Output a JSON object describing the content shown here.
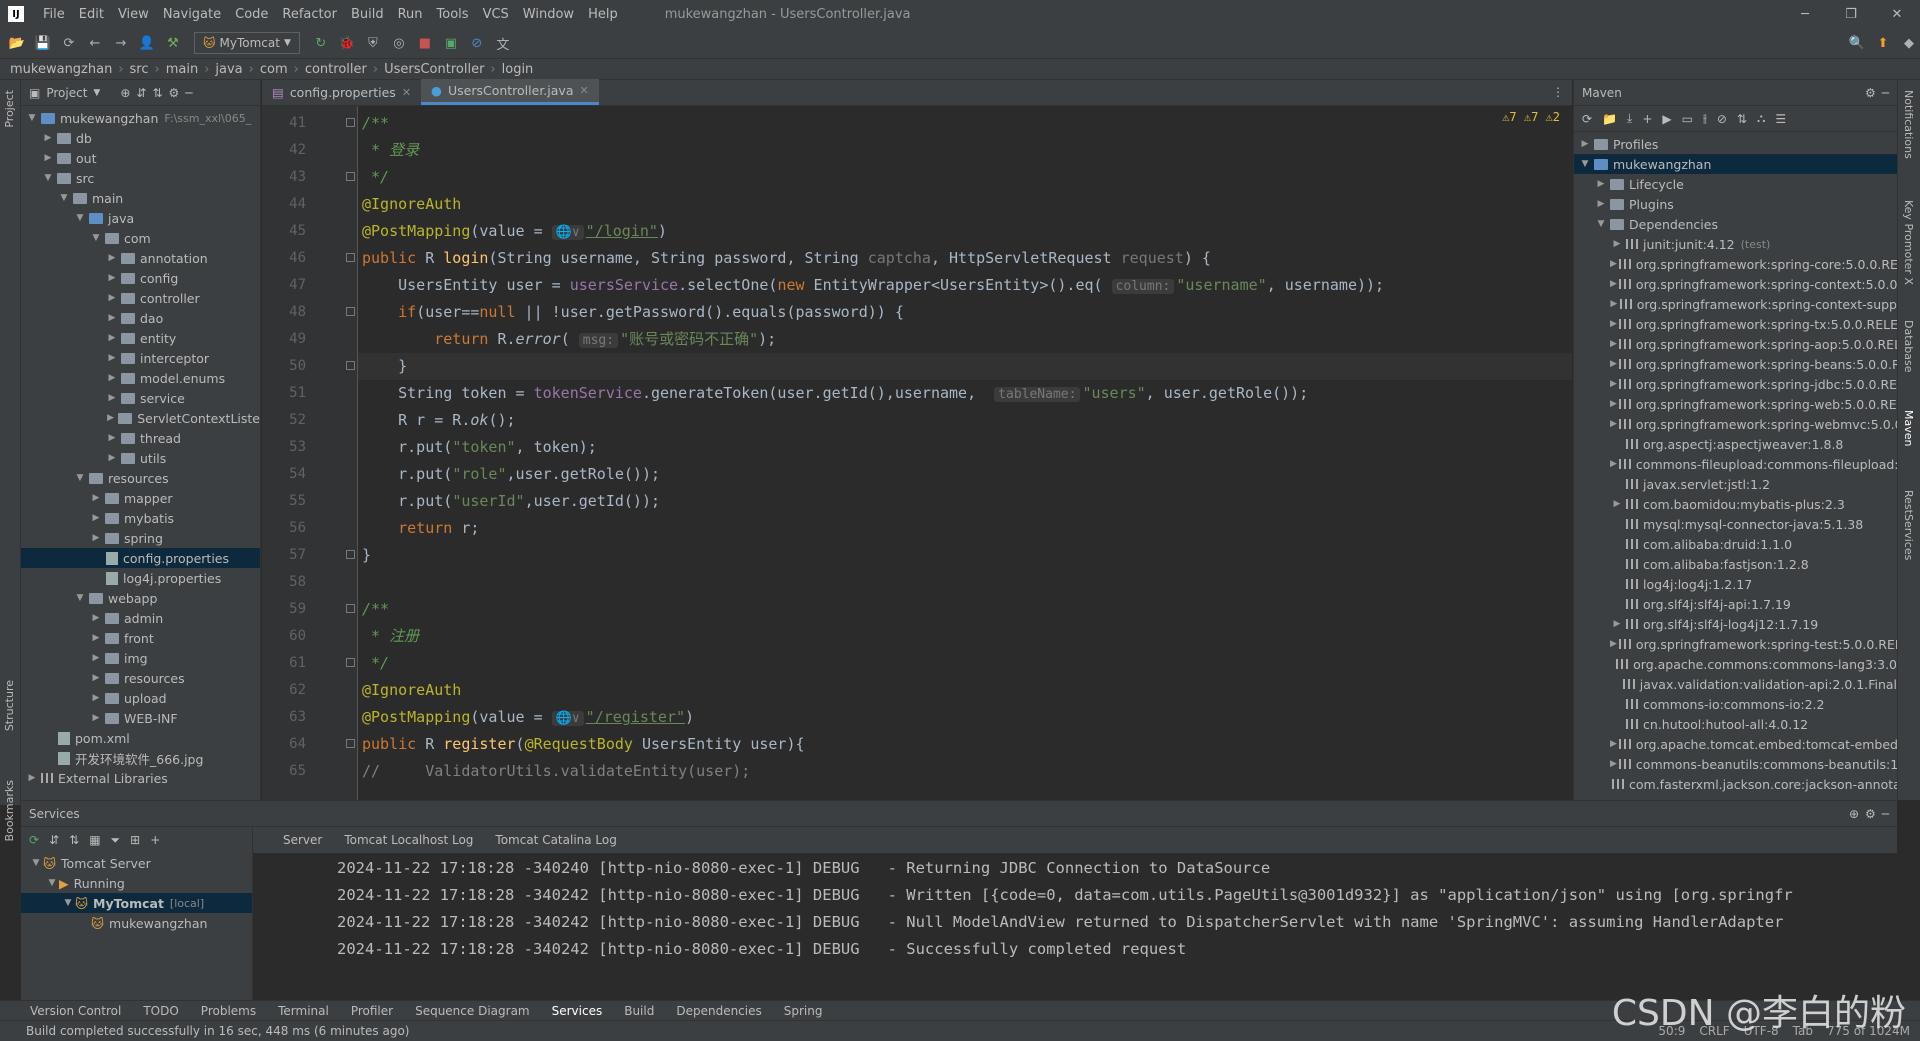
{
  "menubar": {
    "logo": "IJ",
    "items": [
      "File",
      "Edit",
      "View",
      "Navigate",
      "Code",
      "Refactor",
      "Build",
      "Run",
      "Tools",
      "VCS",
      "Window",
      "Help"
    ],
    "title": "mukewangzhan - UsersController.java"
  },
  "toolbar": {
    "run_config": "MyTomcat"
  },
  "breadcrumbs": [
    "mukewangzhan",
    "src",
    "main",
    "java",
    "com",
    "controller",
    "UsersController",
    "login"
  ],
  "project": {
    "header": "Project",
    "tree": [
      {
        "d": 0,
        "label": "mukewangzhan",
        "extra": "F:\\ssm_xxl\\065_",
        "o": true,
        "t": "mod"
      },
      {
        "d": 1,
        "label": "db",
        "o": false,
        "t": "f"
      },
      {
        "d": 1,
        "label": "out",
        "o": false,
        "t": "f"
      },
      {
        "d": 1,
        "label": "src",
        "o": true,
        "t": "f"
      },
      {
        "d": 2,
        "label": "main",
        "o": true,
        "t": "f"
      },
      {
        "d": 3,
        "label": "java",
        "o": true,
        "t": "b"
      },
      {
        "d": 4,
        "label": "com",
        "o": true,
        "t": "f"
      },
      {
        "d": 5,
        "label": "annotation",
        "o": false,
        "t": "f"
      },
      {
        "d": 5,
        "label": "config",
        "o": false,
        "t": "f"
      },
      {
        "d": 5,
        "label": "controller",
        "o": false,
        "t": "f"
      },
      {
        "d": 5,
        "label": "dao",
        "o": false,
        "t": "f"
      },
      {
        "d": 5,
        "label": "entity",
        "o": false,
        "t": "f"
      },
      {
        "d": 5,
        "label": "interceptor",
        "o": false,
        "t": "f"
      },
      {
        "d": 5,
        "label": "model.enums",
        "o": false,
        "t": "f"
      },
      {
        "d": 5,
        "label": "service",
        "o": false,
        "t": "f"
      },
      {
        "d": 5,
        "label": "ServletContextListe",
        "o": false,
        "t": "f"
      },
      {
        "d": 5,
        "label": "thread",
        "o": false,
        "t": "f"
      },
      {
        "d": 5,
        "label": "utils",
        "o": false,
        "t": "f"
      },
      {
        "d": 3,
        "label": "resources",
        "o": true,
        "t": "f"
      },
      {
        "d": 4,
        "label": "mapper",
        "o": false,
        "t": "f"
      },
      {
        "d": 4,
        "label": "mybatis",
        "o": false,
        "t": "f"
      },
      {
        "d": 4,
        "label": "spring",
        "o": false,
        "t": "f"
      },
      {
        "d": 4,
        "label": "config.properties",
        "o": null,
        "t": "file",
        "sel": true
      },
      {
        "d": 4,
        "label": "log4j.properties",
        "o": null,
        "t": "file"
      },
      {
        "d": 3,
        "label": "webapp",
        "o": true,
        "t": "f"
      },
      {
        "d": 4,
        "label": "admin",
        "o": false,
        "t": "f"
      },
      {
        "d": 4,
        "label": "front",
        "o": false,
        "t": "f"
      },
      {
        "d": 4,
        "label": "img",
        "o": false,
        "t": "f"
      },
      {
        "d": 4,
        "label": "resources",
        "o": false,
        "t": "f"
      },
      {
        "d": 4,
        "label": "upload",
        "o": false,
        "t": "f"
      },
      {
        "d": 4,
        "label": "WEB-INF",
        "o": false,
        "t": "f"
      },
      {
        "d": 1,
        "label": "pom.xml",
        "o": null,
        "t": "file"
      },
      {
        "d": 1,
        "label": "开发环境软件_666.jpg",
        "o": null,
        "t": "file"
      },
      {
        "d": 0,
        "label": "External Libraries",
        "o": false,
        "t": "lib"
      }
    ]
  },
  "editor": {
    "tabs": [
      "config.properties",
      "UsersController.java"
    ],
    "warnings": "⚠7  ⚠7  ⚠2",
    "lines": [
      {
        "n": "41",
        "h": "<span class='cm'>/**</span>"
      },
      {
        "n": "42",
        "h": "<span class='cm'> * 登录</span>"
      },
      {
        "n": "43",
        "h": "<span class='cm'> */</span>"
      },
      {
        "n": "44",
        "h": "<span class='an'>@IgnoreAuth</span>"
      },
      {
        "n": "45",
        "h": "<span class='an'>@PostMapping</span>(value = <span class='hint'>🌐∨</span><span class='link'>\"/login\"</span>)"
      },
      {
        "n": "46",
        "h": "<span class='kw'>public</span> R <span class='mth'>login</span>(String username, String password, String <span style='color:#777'>captcha</span>, HttpServletRequest <span style='color:#777'>request</span>) {"
      },
      {
        "n": "47",
        "h": "    UsersEntity user = <span class='fld'>usersService</span>.selectOne(<span class='kw'>new</span> EntityWrapper&lt;UsersEntity&gt;().eq( <span class='hint'>column:</span><span class='str'>\"username\"</span>, username));"
      },
      {
        "n": "48",
        "h": "    <span class='kw'>if</span>(user==<span class='kw'>null</span> || !user.getPassword().equals(password)) {"
      },
      {
        "n": "49",
        "h": "        <span class='kw'>return</span> R.<span class='it'>error</span>( <span class='hint'>msg:</span><span class='str'>\"账号或密码不正确\"</span>);"
      },
      {
        "n": "50",
        "h": "    }"
      },
      {
        "n": "51",
        "h": "    String token = <span class='fld'>tokenService</span>.generateToken(user.getId(),username,  <span class='hint'>tableName:</span><span class='str'>\"users\"</span>, user.getRole());"
      },
      {
        "n": "52",
        "h": "    R r = R.<span class='it'>ok</span>();"
      },
      {
        "n": "53",
        "h": "    r.put(<span class='str'>\"token\"</span>, token);"
      },
      {
        "n": "54",
        "h": "    r.put(<span class='str'>\"role\"</span>,user.getRole());"
      },
      {
        "n": "55",
        "h": "    r.put(<span class='str'>\"userId\"</span>,user.getId());"
      },
      {
        "n": "56",
        "h": "    <span class='kw'>return</span> r;"
      },
      {
        "n": "57",
        "h": "}"
      },
      {
        "n": "58",
        "h": ""
      },
      {
        "n": "59",
        "h": "<span class='cm'>/**</span>"
      },
      {
        "n": "60",
        "h": "<span class='cm'> * 注册</span>"
      },
      {
        "n": "61",
        "h": "<span class='cm'> */</span>"
      },
      {
        "n": "62",
        "h": "<span class='an'>@IgnoreAuth</span>"
      },
      {
        "n": "63",
        "h": "<span class='an'>@PostMapping</span>(value = <span class='hint'>🌐∨</span><span class='link'>\"/register\"</span>)"
      },
      {
        "n": "64",
        "h": "<span class='kw'>public</span> R <span class='mth'>register</span>(<span class='an'>@RequestBody</span> UsersEntity user){"
      },
      {
        "n": "65",
        "h": "<span style='color:#808080'>//     ValidatorUtils.validateEntity(user);</span>"
      }
    ]
  },
  "maven": {
    "header": "Maven",
    "tree": [
      {
        "d": 0,
        "label": "Profiles",
        "o": false,
        "t": "f"
      },
      {
        "d": 0,
        "label": "mukewangzhan",
        "o": true,
        "t": "mod",
        "sel": true
      },
      {
        "d": 1,
        "label": "Lifecycle",
        "o": false,
        "t": "f"
      },
      {
        "d": 1,
        "label": "Plugins",
        "o": false,
        "t": "f"
      },
      {
        "d": 1,
        "label": "Dependencies",
        "o": true,
        "t": "f"
      },
      {
        "d": 2,
        "label": "junit:junit:4.12",
        "extra": "(test)",
        "o": false,
        "t": "dep"
      },
      {
        "d": 2,
        "label": "org.springframework:spring-core:5.0.0.RELE",
        "o": false,
        "t": "dep"
      },
      {
        "d": 2,
        "label": "org.springframework:spring-context:5.0.0.RE",
        "o": false,
        "t": "dep"
      },
      {
        "d": 2,
        "label": "org.springframework:spring-context-supp",
        "o": false,
        "t": "dep"
      },
      {
        "d": 2,
        "label": "org.springframework:spring-tx:5.0.0.RELEA",
        "o": false,
        "t": "dep"
      },
      {
        "d": 2,
        "label": "org.springframework:spring-aop:5.0.0.REL",
        "o": false,
        "t": "dep"
      },
      {
        "d": 2,
        "label": "org.springframework:spring-beans:5.0.0.R",
        "o": false,
        "t": "dep"
      },
      {
        "d": 2,
        "label": "org.springframework:spring-jdbc:5.0.0.REL",
        "o": false,
        "t": "dep"
      },
      {
        "d": 2,
        "label": "org.springframework:spring-web:5.0.0.REL",
        "o": false,
        "t": "dep"
      },
      {
        "d": 2,
        "label": "org.springframework:spring-webmvc:5.0.0",
        "o": false,
        "t": "dep"
      },
      {
        "d": 2,
        "label": "org.aspectj:aspectjweaver:1.8.8",
        "o": null,
        "t": "dep"
      },
      {
        "d": 2,
        "label": "commons-fileupload:commons-fileupload:",
        "o": false,
        "t": "dep"
      },
      {
        "d": 2,
        "label": "javax.servlet:jstl:1.2",
        "o": null,
        "t": "dep"
      },
      {
        "d": 2,
        "label": "com.baomidou:mybatis-plus:2.3",
        "o": false,
        "t": "dep"
      },
      {
        "d": 2,
        "label": "mysql:mysql-connector-java:5.1.38",
        "o": null,
        "t": "dep"
      },
      {
        "d": 2,
        "label": "com.alibaba:druid:1.1.0",
        "o": null,
        "t": "dep"
      },
      {
        "d": 2,
        "label": "com.alibaba:fastjson:1.2.8",
        "o": null,
        "t": "dep"
      },
      {
        "d": 2,
        "label": "log4j:log4j:1.2.17",
        "o": null,
        "t": "dep"
      },
      {
        "d": 2,
        "label": "org.slf4j:slf4j-api:1.7.19",
        "o": null,
        "t": "dep"
      },
      {
        "d": 2,
        "label": "org.slf4j:slf4j-log4j12:1.7.19",
        "o": false,
        "t": "dep"
      },
      {
        "d": 2,
        "label": "org.springframework:spring-test:5.0.0.RELE",
        "o": false,
        "t": "dep"
      },
      {
        "d": 2,
        "label": "org.apache.commons:commons-lang3:3.0",
        "o": null,
        "t": "dep"
      },
      {
        "d": 2,
        "label": "javax.validation:validation-api:2.0.1.Final",
        "o": null,
        "t": "dep"
      },
      {
        "d": 2,
        "label": "commons-io:commons-io:2.2",
        "o": null,
        "t": "dep"
      },
      {
        "d": 2,
        "label": "cn.hutool:hutool-all:4.0.12",
        "o": null,
        "t": "dep"
      },
      {
        "d": 2,
        "label": "org.apache.tomcat.embed:tomcat-embed-",
        "o": false,
        "t": "dep"
      },
      {
        "d": 2,
        "label": "commons-beanutils:commons-beanutils:1.8",
        "o": false,
        "t": "dep"
      },
      {
        "d": 2,
        "label": "com.fasterxml.jackson.core:jackson-annota",
        "o": null,
        "t": "dep"
      }
    ]
  },
  "side_tools": {
    "left": [
      "Project",
      "Structure",
      "Bookmarks"
    ],
    "right": [
      "Notifications",
      "Key Promoter X",
      "Database",
      "Maven",
      "RestServices"
    ]
  },
  "services": {
    "header": "Services",
    "tree": [
      {
        "d": 0,
        "label": "Tomcat Server",
        "o": true
      },
      {
        "d": 1,
        "label": "Running",
        "o": true
      },
      {
        "d": 2,
        "label": "MyTomcat",
        "extra": "[local]",
        "o": true,
        "sel": true
      },
      {
        "d": 3,
        "label": "mukewangzhan",
        "o": null
      }
    ],
    "log_tabs": [
      "Server",
      "Tomcat Localhost Log",
      "Tomcat Catalina Log"
    ],
    "log": [
      "2024-11-22 17:18:28 -340240 [http-nio-8080-exec-1] DEBUG   - Returning JDBC Connection to DataSource",
      "2024-11-22 17:18:28 -340242 [http-nio-8080-exec-1] DEBUG   - Written [{code=0, data=com.utils.PageUtils@3001d932}] as \"application/json\" using [org.springfr",
      "2024-11-22 17:18:28 -340242 [http-nio-8080-exec-1] DEBUG   - Null ModelAndView returned to DispatcherServlet with name 'SpringMVC': assuming HandlerAdapter",
      "2024-11-22 17:18:28 -340242 [http-nio-8080-exec-1] DEBUG   - Successfully completed request"
    ]
  },
  "bottom_tools": [
    "Version Control",
    "TODO",
    "Problems",
    "Terminal",
    "Profiler",
    "Sequence Diagram",
    "Services",
    "Build",
    "Dependencies",
    "Spring"
  ],
  "status": {
    "message": "Build completed successfully in 16 sec, 448 ms (6 minutes ago)",
    "position": "50:9",
    "line_sep": "CRLF",
    "encoding": "UTF-8",
    "indent": "Tab",
    "memory": "775 of 1024M"
  },
  "watermark": "CSDN @李白的粉"
}
